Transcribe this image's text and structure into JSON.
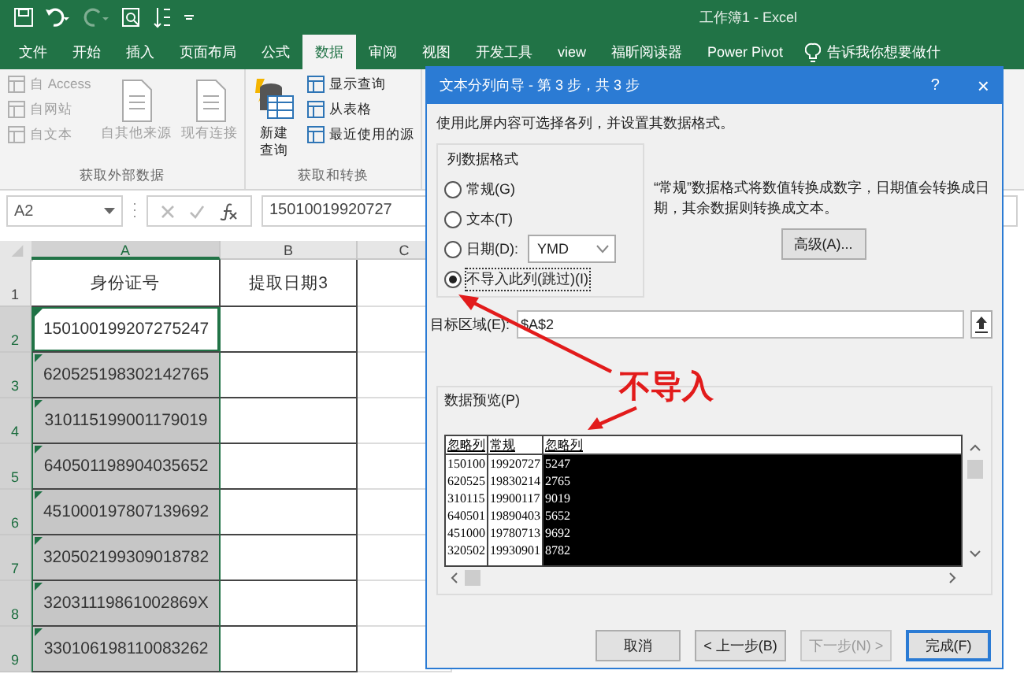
{
  "window": {
    "title": "工作簿1 - Excel"
  },
  "tabs": [
    {
      "label": "文件",
      "selected": false
    },
    {
      "label": "开始",
      "selected": false
    },
    {
      "label": "插入",
      "selected": false
    },
    {
      "label": "页面布局",
      "selected": false
    },
    {
      "label": "公式",
      "selected": false
    },
    {
      "label": "数据",
      "selected": true
    },
    {
      "label": "审阅",
      "selected": false
    },
    {
      "label": "视图",
      "selected": false
    },
    {
      "label": "开发工具",
      "selected": false
    },
    {
      "label": "view",
      "selected": false
    },
    {
      "label": "福昕阅读器",
      "selected": false
    },
    {
      "label": "Power Pivot",
      "selected": false
    }
  ],
  "tell_me": "告诉我你想要做什",
  "ribbon_groups": [
    {
      "label": "获取外部数据",
      "items": [
        {
          "kind": "small",
          "label": "自 Access",
          "disabled": true
        },
        {
          "kind": "small",
          "label": "自网站",
          "disabled": true
        },
        {
          "kind": "small",
          "label": "自文本",
          "disabled": true
        },
        {
          "kind": "large",
          "label": "自其他来源",
          "disabled": true
        },
        {
          "kind": "large",
          "label": "现有连接",
          "disabled": true
        }
      ]
    },
    {
      "label": "获取和转换",
      "items": [
        {
          "kind": "large",
          "label": "新建查询",
          "disabled": false
        },
        {
          "kind": "small",
          "label": "显示查询",
          "disabled": false
        },
        {
          "kind": "small",
          "label": "从表格",
          "disabled": false
        },
        {
          "kind": "small",
          "label": "最近使用的源",
          "disabled": false
        }
      ]
    }
  ],
  "formula_bar": {
    "name_box": "A2",
    "formula": "15010019920727"
  },
  "sheet": {
    "columns": [
      {
        "label": "A",
        "selected": true
      },
      {
        "label": "B",
        "selected": false
      },
      {
        "label": "C",
        "selected": false
      }
    ],
    "rows": [
      {
        "number": "1",
        "selected": false,
        "active": false,
        "error_flag": false,
        "cells": [
          "身份证号",
          "提取日期3"
        ]
      },
      {
        "number": "2",
        "selected": true,
        "active": true,
        "error_flag": true,
        "cells": [
          "150100199207275247"
        ]
      },
      {
        "number": "3",
        "selected": true,
        "active": false,
        "error_flag": true,
        "cells": [
          "620525198302142765"
        ]
      },
      {
        "number": "4",
        "selected": true,
        "active": false,
        "error_flag": true,
        "cells": [
          "310115199001179019"
        ]
      },
      {
        "number": "5",
        "selected": true,
        "active": false,
        "error_flag": true,
        "cells": [
          "640501198904035652"
        ]
      },
      {
        "number": "6",
        "selected": true,
        "active": false,
        "error_flag": true,
        "cells": [
          "451000197807139692"
        ]
      },
      {
        "number": "7",
        "selected": true,
        "active": false,
        "error_flag": true,
        "cells": [
          "320502199309018782"
        ]
      },
      {
        "number": "8",
        "selected": true,
        "active": false,
        "error_flag": true,
        "cells": [
          "32031119861002869X"
        ]
      },
      {
        "number": "9",
        "selected": true,
        "active": false,
        "error_flag": true,
        "cells": [
          "330106198110083262"
        ]
      }
    ]
  },
  "dialog": {
    "title": "文本分列向导 - 第 3 步，共 3 步",
    "help": "?",
    "close": "×",
    "instruction": "使用此屏内容可选择各列，并设置其数据格式。",
    "format_group": {
      "label": "列数据格式",
      "options": [
        {
          "kind": "plain",
          "label": "常规(G)",
          "selected": false
        },
        {
          "kind": "plain",
          "label": "文本(T)",
          "selected": false
        },
        {
          "kind": "date",
          "label": "日期(D):",
          "selected": false,
          "date_format": "YMD"
        },
        {
          "kind": "plain",
          "label": "不导入此列(跳过)(I)",
          "selected": true
        }
      ]
    },
    "description": "“常规”数据格式将数值转换成数字，日期值会转换成日期，其余数据则转换成文本。",
    "advanced_button": "高级(A)...",
    "destination": {
      "label": "目标区域(E):",
      "value": "$A$2"
    },
    "preview": {
      "label": "数据预览(P)",
      "columns": [
        {
          "header": "忽略列",
          "selected": false,
          "values": [
            "150100",
            "620525",
            "310115",
            "640501",
            "451000",
            "320502"
          ]
        },
        {
          "header": "常规",
          "selected": false,
          "values": [
            "19920727",
            "19830214",
            "19900117",
            "19890403",
            "19780713",
            "19930901"
          ]
        },
        {
          "header": "忽略列",
          "selected": true,
          "values": [
            "5247",
            "2765",
            "9019",
            "5652",
            "9692",
            "8782"
          ]
        }
      ]
    },
    "buttons": [
      {
        "label": "取消",
        "disabled": false,
        "default": false
      },
      {
        "label": "< 上一步(B)",
        "disabled": false,
        "default": false
      },
      {
        "label": "下一步(N) >",
        "disabled": true,
        "default": false
      },
      {
        "label": "完成(F)",
        "disabled": false,
        "default": true
      }
    ]
  },
  "annotation": {
    "text": "不导入"
  }
}
